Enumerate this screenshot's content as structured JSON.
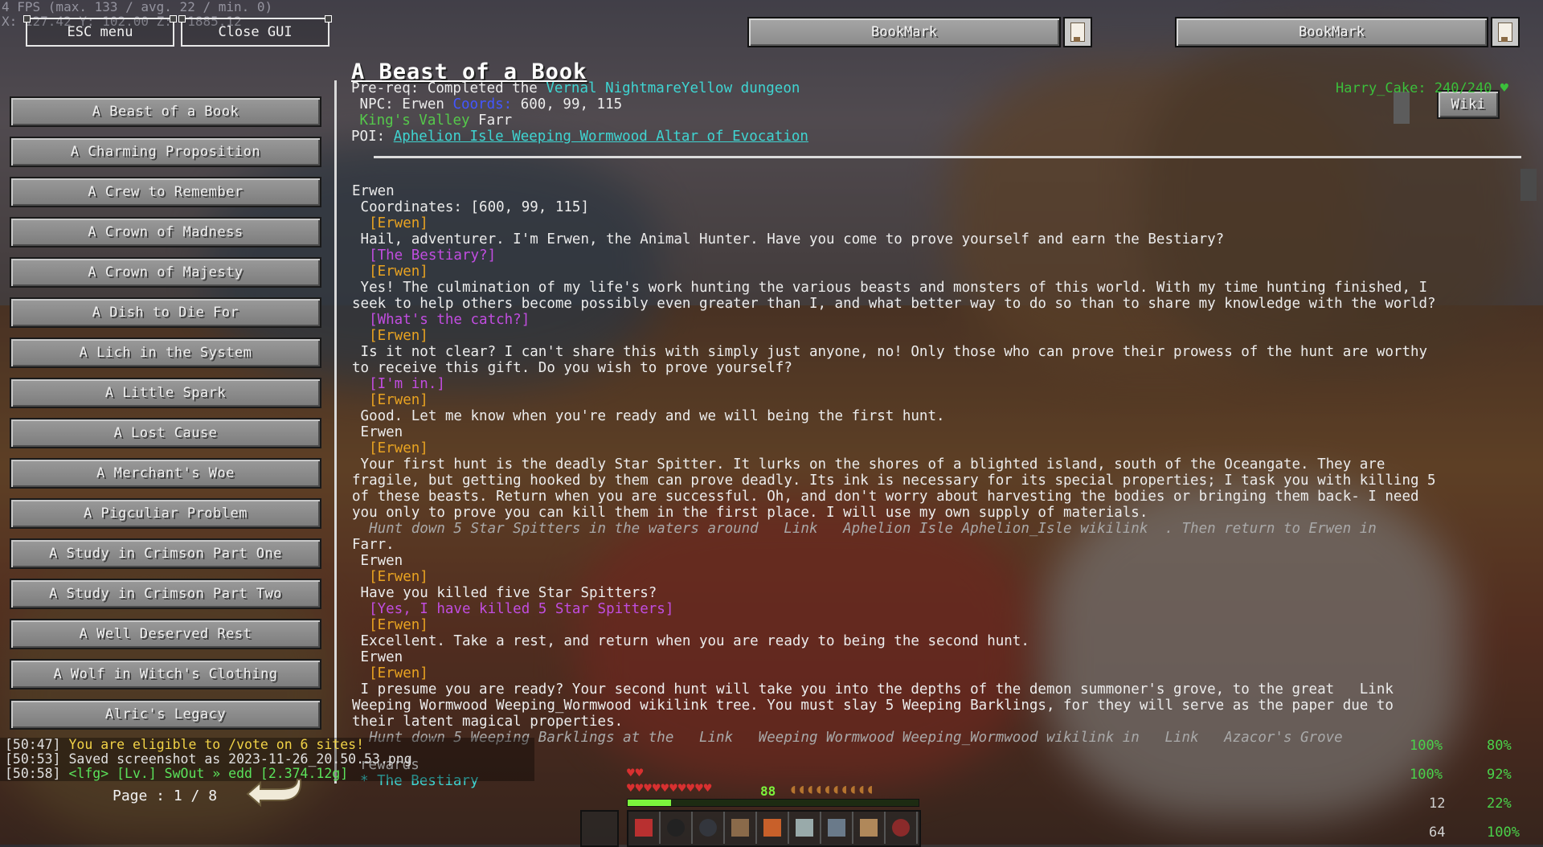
{
  "debug": {
    "fps_line": "4 FPS (max. 133 / avg. 22 / min. 0)",
    "coords_line": "X: 127.42 Y: 102.00 Z: -1885.12"
  },
  "top_buttons": {
    "esc_menu": "ESC menu",
    "close_gui": "Close GUI",
    "bookmark1": "BookMark",
    "bookmark2": "BookMark"
  },
  "quest_list": [
    "A Beast of a Book",
    "A Charming Proposition",
    "A Crew to Remember",
    "A Crown of Madness",
    "A Crown of Majesty",
    "A Dish to Die For",
    "A Lich in the System",
    "A Little Spark",
    "A Lost Cause",
    "A Merchant's Woe",
    "A Pigculiar Problem",
    "A Study in Crimson Part One",
    "A Study in Crimson Part Two",
    "A Well Deserved Rest",
    "A Wolf in Witch's Clothing",
    "Alric's Legacy"
  ],
  "page": "Page : 1 / 8",
  "quest": {
    "title": "A Beast of a Book",
    "prereq_label": "Pre-req: Completed the ",
    "prereq_value": "Vernal NightmareYellow dungeon",
    "npc_label": " NPC: Erwen ",
    "coords_label": "Coords:",
    "coords_value": " 600, 99, 115",
    "region": "King's Valley",
    "town": " Farr",
    "poi_label": "POI: ",
    "poi_value": "Aphelion Isle Weeping Wormwood Altar of Evocation",
    "wiki": "Wiki",
    "player": "Harry_Cake: 240/240 ♥"
  },
  "dialogue": [
    {
      "c": "white",
      "t": "Erwen"
    },
    {
      "c": "white",
      "t": " Coordinates: [600, 99, 115]"
    },
    {
      "c": "gold",
      "t": "  [Erwen]"
    },
    {
      "c": "white",
      "t": " Hail, adventurer. I'm Erwen, the Animal Hunter. Have you come to prove yourself and earn the Bestiary?"
    },
    {
      "c": "purple",
      "t": "  [The Bestiary?]"
    },
    {
      "c": "gold",
      "t": "  [Erwen]"
    },
    {
      "c": "white",
      "t": " Yes! The culmination of my life's work hunting the various beasts and monsters of this world. With my time hunting finished, I"
    },
    {
      "c": "white",
      "t": "seek to help others become possibly even greater than I, and what better way to do so than to share my knowledge with the world?"
    },
    {
      "c": "purple",
      "t": "  [What's the catch?]"
    },
    {
      "c": "gold",
      "t": "  [Erwen]"
    },
    {
      "c": "white",
      "t": " Is it not clear? I can't share this with simply just anyone, no! Only those who can prove their prowess of the hunt are worthy"
    },
    {
      "c": "white",
      "t": "to receive this gift. Do you wish to prove yourself?"
    },
    {
      "c": "purple",
      "t": "  [I'm in.]"
    },
    {
      "c": "gold",
      "t": "  [Erwen]"
    },
    {
      "c": "white",
      "t": " Good. Let me know when you're ready and we will being the first hunt."
    },
    {
      "c": "white",
      "t": " Erwen"
    },
    {
      "c": "gold",
      "t": "  [Erwen]"
    },
    {
      "c": "white",
      "t": " Your first hunt is the deadly Star Spitter. It lurks on the shores of a blighted island, south of the Oceangate. They are"
    },
    {
      "c": "white",
      "t": "fragile, but getting hooked by them can prove deadly. Its ink is necessary for its special properties; I task you with killing 5"
    },
    {
      "c": "white",
      "t": "of these beasts. Return when you are successful. Oh, and don't worry about harvesting the bodies or bringing them back- I need"
    },
    {
      "c": "white",
      "t": "you only to prove you can kill them in the first place. I will use my own supply of materials."
    },
    {
      "c": "gray",
      "t": "  Hunt down 5 Star Spitters in the waters around   Link   Aphelion Isle Aphelion_Isle wikilink  . Then return to Erwen in"
    },
    {
      "c": "white",
      "t": "Farr."
    },
    {
      "c": "white",
      "t": " Erwen"
    },
    {
      "c": "gold",
      "t": "  [Erwen]"
    },
    {
      "c": "white",
      "t": " Have you killed five Star Spitters?"
    },
    {
      "c": "purple",
      "t": "  [Yes, I have killed 5 Star Spitters]"
    },
    {
      "c": "gold",
      "t": "  [Erwen]"
    },
    {
      "c": "white",
      "t": " Excellent. Take a rest, and return when you are ready to being the second hunt."
    },
    {
      "c": "white",
      "t": " Erwen"
    },
    {
      "c": "gold",
      "t": "  [Erwen]"
    },
    {
      "c": "white",
      "t": " I presume you are ready? Your second hunt will take you into the depths of the demon summoner's grove, to the great   Link"
    },
    {
      "c": "white",
      "t": "Weeping Wormwood Weeping_Wormwood wikilink tree. You must slay 5 Weeping Barklings, for they will serve as the paper due to"
    },
    {
      "c": "white",
      "t": "their latent magical properties."
    },
    {
      "c": "gray",
      "t": "  Hunt down 5 Weeping Barklings at the   Link   Weeping Wormwood Weeping_Wormwood wikilink in   Link   Azacor's Grove"
    }
  ],
  "rewards": {
    "label": "rewards",
    "item": "* The Bestiary"
  },
  "chat": [
    {
      "time": "[50:47]",
      "text": " You are eligible to /vote on 6 sites!"
    },
    {
      "time": "[50:53]",
      "text": " Saved screenshot as 2023-11-26_20.50.53.png"
    },
    {
      "time": "[50:58]",
      "text": " <lfg> [Lv.] SwOut » edd [2.374.12g]"
    }
  ],
  "hud": {
    "xp_level": "88",
    "stat1": "100%",
    "stat2": "80%",
    "stat3": "100%",
    "stat4": "92%",
    "stat5": "12",
    "stat6": "22%",
    "stat7": "64",
    "stat8": "100%",
    "xp_fraction": 0.15
  }
}
